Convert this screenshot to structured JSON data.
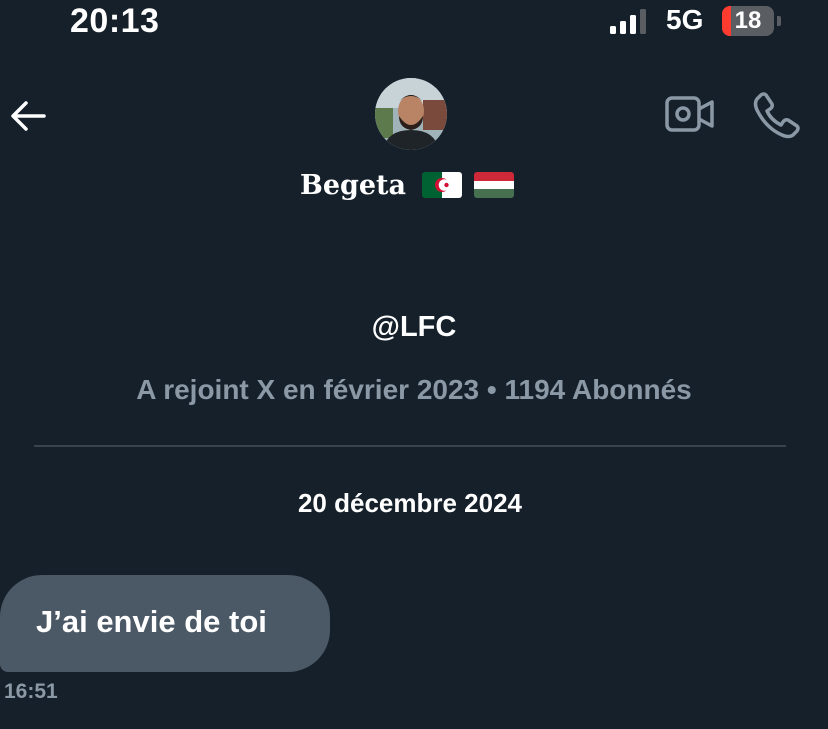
{
  "status_bar": {
    "time": "20:13",
    "network": "5G",
    "battery_level": "18",
    "battery_fraction": 0.18
  },
  "header": {
    "back_icon": "arrow-left-icon",
    "video_icon": "video-call-icon",
    "phone_icon": "phone-call-icon",
    "display_name": "Begeta",
    "flags": [
      "algeria-flag-icon",
      "hungary-flag-icon"
    ]
  },
  "profile": {
    "handle": "@LFC",
    "meta": "A rejoint X en février 2023 • 1194 Abonnés"
  },
  "conversation": {
    "date_separator": "20 décembre 2024",
    "messages": [
      {
        "text": "J’ai envie de toi",
        "time": "16:51"
      }
    ]
  },
  "colors": {
    "background": "#15202b",
    "bubble": "#4b5866",
    "muted_text": "#8b98a5",
    "divider": "#38444d",
    "battery_low": "#ff3b30"
  }
}
